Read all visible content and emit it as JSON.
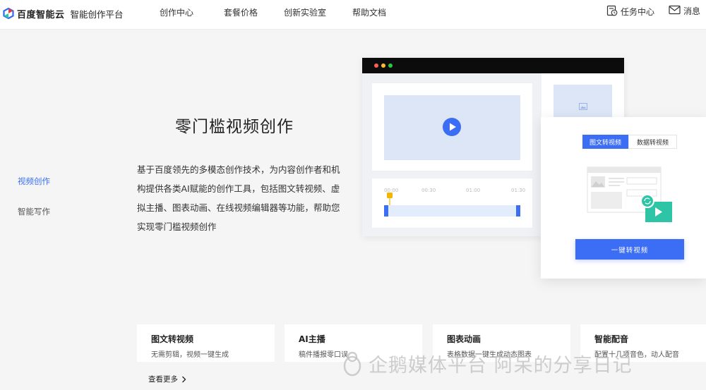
{
  "header": {
    "brand": "百度智能云",
    "product": "智能创作平台",
    "nav": [
      "创作中心",
      "套餐价格",
      "创新实验室",
      "帮助文档"
    ],
    "task_center": "任务中心",
    "messages": "消息"
  },
  "sidebar": {
    "items": [
      {
        "label": "视频创作",
        "active": true
      },
      {
        "label": "智能写作",
        "active": false
      }
    ]
  },
  "hero": {
    "title": "零门槛视频创作",
    "description": "基于百度领先的多模态创作技术，为内容创作者和机构提供各类AI赋能的创作工具，包括图文转视频、虚拟主播、图表动画、在线视频编辑器等功能，帮助您实现零门槛视频创作"
  },
  "mockup": {
    "timeline_ticks": [
      "00:00",
      "00:30",
      "01:00",
      "01:30"
    ],
    "tabs": [
      "图文转视频",
      "数据转视频"
    ],
    "convert_button": "一键转视频"
  },
  "features": [
    {
      "title": "图文转视频",
      "subtitle": "无需剪辑，视频一键生成"
    },
    {
      "title": "AI主播",
      "subtitle": "稿件播报零口误"
    },
    {
      "title": "图表动画",
      "subtitle": "表格数据一键生成动态图表"
    },
    {
      "title": "智能配音",
      "subtitle": "配置十几项音色，动人配音"
    }
  ],
  "more_link": "查看更多",
  "watermark": "企鹅媒体平台 阿呆的分享日记",
  "colors": {
    "accent": "#3b6ef5",
    "background": "#f5f5f6",
    "play_badge": "#2ec4a6",
    "scrubber": "#f5b400"
  }
}
